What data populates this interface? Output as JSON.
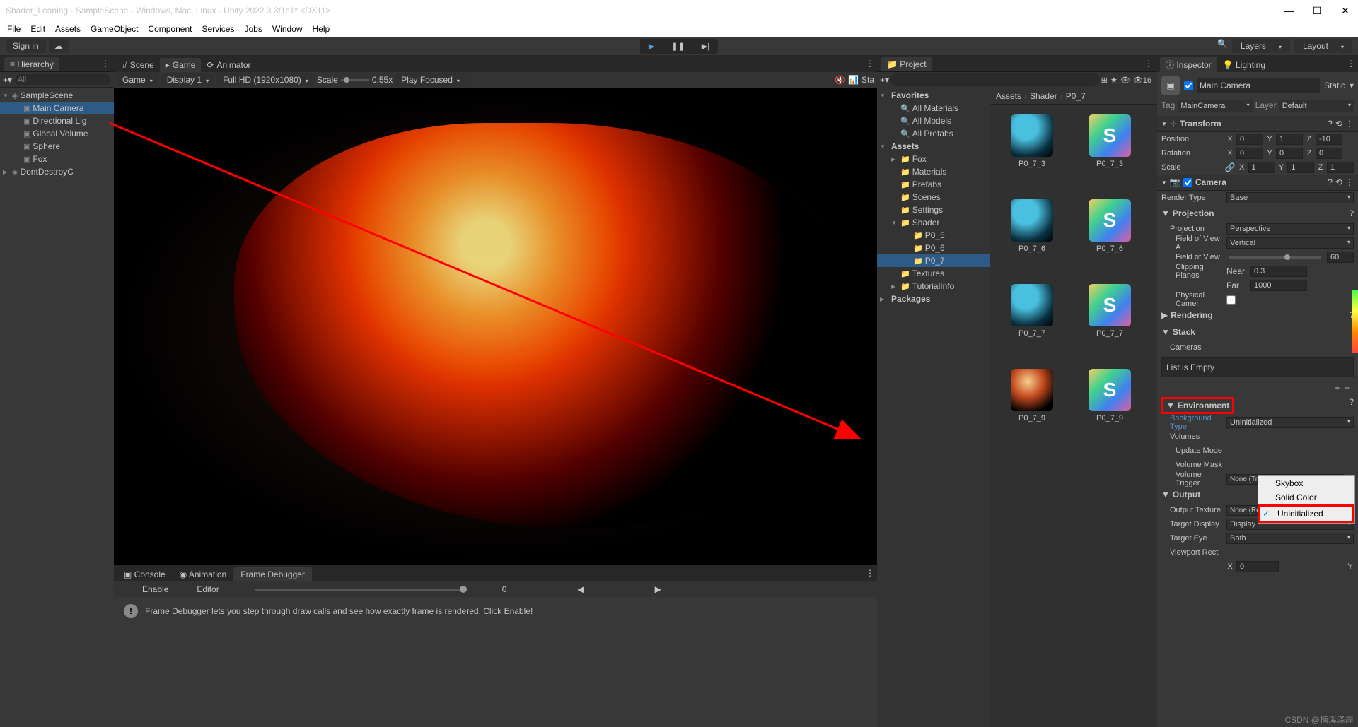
{
  "window": {
    "title": "Shader_Leaning - SampleScene - Windows, Mac, Linux - Unity 2022.3.3f1c1* <DX11>"
  },
  "menubar": [
    "File",
    "Edit",
    "Assets",
    "GameObject",
    "Component",
    "Services",
    "Jobs",
    "Window",
    "Help"
  ],
  "signin": "Sign in",
  "topdropdowns": {
    "layers": "Layers",
    "layout": "Layout"
  },
  "hierarchy": {
    "title": "Hierarchy",
    "search": "All",
    "items": [
      {
        "name": "SampleScene",
        "indent": 0,
        "arrow": "▼",
        "icon": "◈"
      },
      {
        "name": "Main Camera",
        "indent": 1,
        "icon": "▣",
        "sel": true
      },
      {
        "name": "Directional Lig",
        "indent": 1,
        "icon": "▣"
      },
      {
        "name": "Global Volume",
        "indent": 1,
        "icon": "▣"
      },
      {
        "name": "Sphere",
        "indent": 1,
        "icon": "▣"
      },
      {
        "name": "Fox",
        "indent": 1,
        "icon": "▣"
      },
      {
        "name": "DontDestroyC",
        "indent": 0,
        "arrow": "▶",
        "icon": "◈"
      }
    ]
  },
  "scene": {
    "tabs": [
      "Scene",
      "Game",
      "Animator"
    ],
    "toolbar": {
      "mode": "Game",
      "display": "Display 1",
      "res": "Full HD (1920x1080)",
      "scale": "Scale",
      "scaleval": "0.55x",
      "play": "Play Focused",
      "stats": "Sta"
    }
  },
  "bottom": {
    "tabs": [
      "Console",
      "Animation",
      "Frame Debugger"
    ],
    "toolbar": {
      "enable": "Enable",
      "editor": "Editor",
      "zero": "0"
    },
    "msg": "Frame Debugger lets you step through draw calls and see how exactly frame is rendered. Click Enable!"
  },
  "project": {
    "title": "Project",
    "vis": "16",
    "tree": [
      {
        "name": "Favorites",
        "indent": 0,
        "arrow": "▼",
        "bold": true
      },
      {
        "name": "All Materials",
        "indent": 1,
        "icon": "🔍"
      },
      {
        "name": "All Models",
        "indent": 1,
        "icon": "🔍"
      },
      {
        "name": "All Prefabs",
        "indent": 1,
        "icon": "🔍"
      },
      {
        "name": "Assets",
        "indent": 0,
        "arrow": "▼",
        "bold": true
      },
      {
        "name": "Fox",
        "indent": 1,
        "icon": "📁",
        "arrow": "▶"
      },
      {
        "name": "Materials",
        "indent": 1,
        "icon": "📁"
      },
      {
        "name": "Prefabs",
        "indent": 1,
        "icon": "📁"
      },
      {
        "name": "Scenes",
        "indent": 1,
        "icon": "📁"
      },
      {
        "name": "Settings",
        "indent": 1,
        "icon": "📁"
      },
      {
        "name": "Shader",
        "indent": 1,
        "icon": "📁",
        "arrow": "▼"
      },
      {
        "name": "P0_5",
        "indent": 2,
        "icon": "📁"
      },
      {
        "name": "P0_6",
        "indent": 2,
        "icon": "📁"
      },
      {
        "name": "P0_7",
        "indent": 2,
        "icon": "📁",
        "sel": true
      },
      {
        "name": "Textures",
        "indent": 1,
        "icon": "📁"
      },
      {
        "name": "TutorialInfo",
        "indent": 1,
        "icon": "📁",
        "arrow": "▶"
      },
      {
        "name": "Packages",
        "indent": 0,
        "arrow": "▶",
        "bold": true
      }
    ],
    "breadcrumb": [
      "Assets",
      "Shader",
      "P0_7"
    ],
    "grid": [
      {
        "lbl": "P0_7_3",
        "type": "sphere"
      },
      {
        "lbl": "P0_7_3",
        "type": "shader"
      },
      {
        "lbl": "P0_7_6",
        "type": "sphere"
      },
      {
        "lbl": "P0_7_6",
        "type": "shader"
      },
      {
        "lbl": "P0_7_7",
        "type": "sphere"
      },
      {
        "lbl": "P0_7_7",
        "type": "shader"
      },
      {
        "lbl": "P0_7_9",
        "type": "marble"
      },
      {
        "lbl": "P0_7_9",
        "type": "shader"
      }
    ]
  },
  "inspector": {
    "tabs": [
      "Inspector",
      "Lighting"
    ],
    "go": {
      "name": "Main Camera",
      "static": "Static",
      "tag": "Tag",
      "tagval": "MainCamera",
      "layer": "Layer",
      "layerval": "Default"
    },
    "transform": {
      "title": "Transform",
      "pos": "Position",
      "rot": "Rotation",
      "scl": "Scale",
      "px": "0",
      "py": "1",
      "pz": "-10",
      "rx": "0",
      "ry": "0",
      "rz": "0",
      "sx": "1",
      "sy": "1",
      "sz": "1"
    },
    "camera": {
      "title": "Camera",
      "rendertype": "Render Type",
      "rendertypeval": "Base",
      "projection": "Projection",
      "projlbl": "Projection",
      "projval": "Perspective",
      "fovaxis": "Field of View A",
      "fovaxisval": "Vertical",
      "fov": "Field of View",
      "fovval": "60",
      "clip": "Clipping Planes",
      "near": "Near",
      "nearval": "0.3",
      "far": "Far",
      "farval": "1000",
      "phys": "Physical Camer",
      "rendering": "Rendering",
      "stack": "Stack",
      "cameras": "Cameras",
      "empty": "List is Empty",
      "env": "Environment",
      "bgtype": "Background Type",
      "bgtypeval": "Uninitialized",
      "volumes": "Volumes",
      "update": "Update Mode",
      "vmask": "Volume Mask",
      "vtrigger": "Volume Trigger",
      "vtriggerval": "None (Transform)",
      "output": "Output",
      "outtex": "Output Texture",
      "outtexval": "None (Render Textu",
      "tdisplay": "Target Display",
      "tdisplayval": "Display 1",
      "teye": "Target Eye",
      "teyeval": "Both",
      "vrect": "Viewport Rect",
      "vrx": "0"
    },
    "dropdown": [
      "Skybox",
      "Solid Color",
      "Uninitialized"
    ]
  },
  "watermark": "CSDN @楠溪泽岸"
}
